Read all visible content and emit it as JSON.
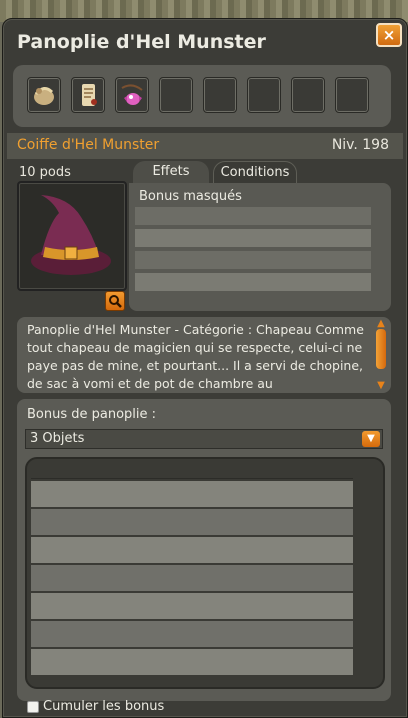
{
  "window": {
    "title": "Panoplie d'Hel Munster",
    "close_label": "×"
  },
  "slots": {
    "items": [
      {
        "icon": "pouch-icon"
      },
      {
        "icon": "scroll-icon"
      },
      {
        "icon": "candy-amulet-icon"
      },
      {
        "icon": "empty-slot"
      },
      {
        "icon": "empty-slot"
      },
      {
        "icon": "empty-slot"
      },
      {
        "icon": "empty-slot"
      },
      {
        "icon": "empty-slot"
      }
    ]
  },
  "item": {
    "name": "Coiffe d'Hel Munster",
    "level": "Niv. 198",
    "pods": "10 pods",
    "image_icon": "witch-hat-icon"
  },
  "tabs": {
    "effets": "Effets",
    "conditions": "Conditions"
  },
  "effects": {
    "first_row": "Bonus masqués"
  },
  "description": {
    "text": "Panoplie d'Hel Munster - Catégorie : Chapeau Comme tout chapeau de magicien qui se respecte, celui-ci ne paye pas de mine, et pourtant... Il a servi de chopine, de sac à vomi et de pot de chambre au"
  },
  "bonus": {
    "label": "Bonus de panoplie :",
    "selected": "3 Objets",
    "cumulate_label": "Cumuler les bonus"
  },
  "colors": {
    "accent": "#f0a030",
    "panel": "#5b5b55",
    "window": "#3c3c37"
  }
}
